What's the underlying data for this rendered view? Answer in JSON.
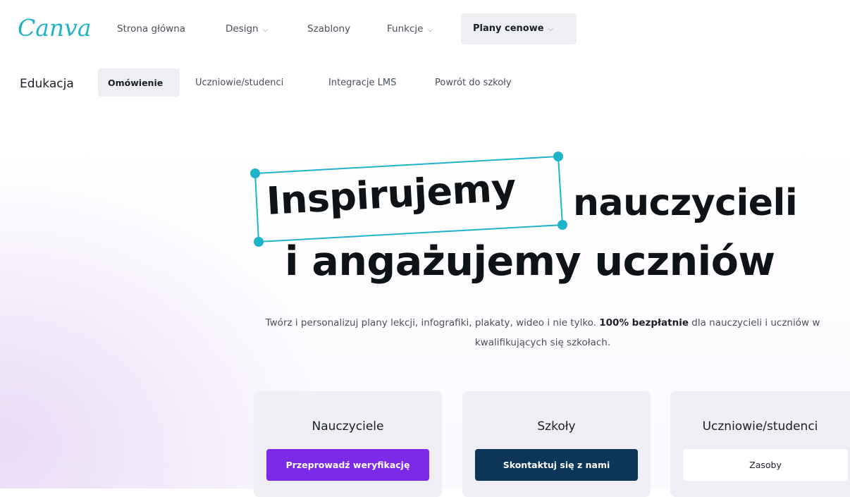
{
  "colors": {
    "logo": "#1fb3c9",
    "accent_handles": "#1fb3c9",
    "purple_button": "#7d2ae8",
    "navy_button": "#0c3558"
  },
  "topnav": {
    "logo": "Canva",
    "items": [
      {
        "label": "Strona główna"
      },
      {
        "label": "Design",
        "icon": "chevron-down-icon"
      },
      {
        "label": "Szablony"
      },
      {
        "label": "Funkcje",
        "icon": "chevron-down-icon"
      },
      {
        "label": "Plany cenowe",
        "icon": "chevron-down-icon"
      }
    ]
  },
  "subnav": {
    "title": "Edukacja",
    "tabs": [
      {
        "label": "Omówienie"
      },
      {
        "label": "Uczniowie/studenci"
      },
      {
        "label": "Integracje LMS"
      },
      {
        "label": "Powrót do szkoły"
      }
    ]
  },
  "hero": {
    "highlight_word": "Inspirujemy",
    "line1_rest": "nauczycieli",
    "line2": "i angażujemy uczniów",
    "subtitle_part1": "Twórz i personalizuj plany lekcji, infografiki, plakaty, wideo i nie tylko. ",
    "subtitle_bold": "100% bezpłatnie",
    "subtitle_part2": " dla nauczycieli i uczniów w kwalifikujących się szkołach."
  },
  "cards": [
    {
      "title": "Nauczyciele",
      "button": "Przeprowadź weryfikację"
    },
    {
      "title": "Szkoły",
      "button": "Skontaktuj się z nami"
    },
    {
      "title": "Uczniowie/studenci",
      "button": "Zasoby"
    }
  ]
}
